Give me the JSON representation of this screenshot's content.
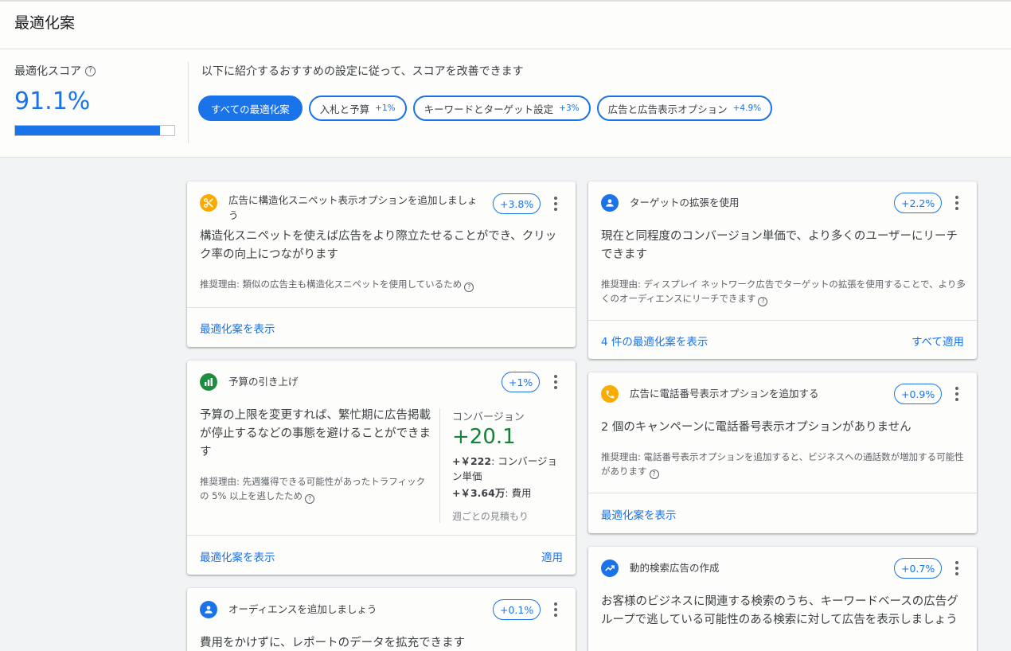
{
  "header": {
    "title": "最適化案",
    "score_label": "最適化スコア",
    "score_value": "91.1%",
    "score_progress": 0.911,
    "intro": "以下に紹介するおすすめの設定に従って、スコアを改善できます",
    "chips": [
      {
        "label": "すべての最適化案",
        "delta": ""
      },
      {
        "label": "入札と予算",
        "delta": "+1%"
      },
      {
        "label": "キーワードとターゲット設定",
        "delta": "+3%"
      },
      {
        "label": "広告と広告表示オプション",
        "delta": "+4.9%"
      }
    ]
  },
  "colors": {
    "accent": "#1a73e8",
    "orange": "#f9ab00",
    "green": "#188038",
    "bar_green": "#1e8e3e"
  },
  "cards": {
    "snippet": {
      "icon": "scissors-icon",
      "title": "広告に構造化スニペット表示オプションを追加しましょう",
      "badge": "+3.8%",
      "desc": "構造化スニペットを使えば広告をより際立たせることができ、クリック率の向上につながります",
      "reason": "推奨理由: 類似の広告主も構造化スニペットを使用しているため",
      "link": "最適化案を表示"
    },
    "budget": {
      "icon": "bar-chart-icon",
      "title": "予算の引き上げ",
      "badge": "+1%",
      "desc": "予算の上限を変更すれば、繁忙期に広告掲載が停止するなどの事態を避けることができます",
      "reason": "推奨理由: 先週獲得できる可能性があったトラフィックの 5% 以上を逃したため",
      "conv_label": "コンバージョン",
      "conv_value": "+20.1",
      "conv_cpa_value": "+￥222",
      "conv_cpa_label": ": コンバージョン単価",
      "conv_cost_value": "+￥3.64万",
      "conv_cost_label": ": 費用",
      "conv_note": "週ごとの見積もり",
      "link": "最適化案を表示",
      "apply": "適用"
    },
    "audience": {
      "icon": "person-icon",
      "title": "オーディエンスを追加しましょう",
      "badge": "+0.1%",
      "desc": "費用をかけずに、レポートのデータを拡充できます"
    },
    "targeting": {
      "icon": "person-icon",
      "title": "ターゲットの拡張を使用",
      "badge": "+2.2%",
      "desc": "現在と同程度のコンバージョン単価で、より多くのユーザーにリーチできます",
      "reason": "推奨理由: ディスプレイ ネットワーク広告でターゲットの拡張を使用することで、より多くのオーディエンスにリーチできます",
      "link": "4 件の最適化案を表示",
      "apply": "すべて適用"
    },
    "phone": {
      "icon": "phone-icon",
      "title": "広告に電話番号表示オプションを追加する",
      "badge": "+0.9%",
      "desc": "2 個のキャンペーンに電話番号表示オプションがありません",
      "reason": "推奨理由: 電話番号表示オプションを追加すると、ビジネスへの通話数が増加する可能性があります",
      "link": "最適化案を表示"
    },
    "dsa": {
      "icon": "trending-up-icon",
      "title": "動的検索広告の作成",
      "badge": "+0.7%",
      "desc": "お客様のビジネスに関連する検索のうち、キーワードベースの広告グループで逃している可能性のある検索に対して広告を表示しましょう"
    }
  }
}
